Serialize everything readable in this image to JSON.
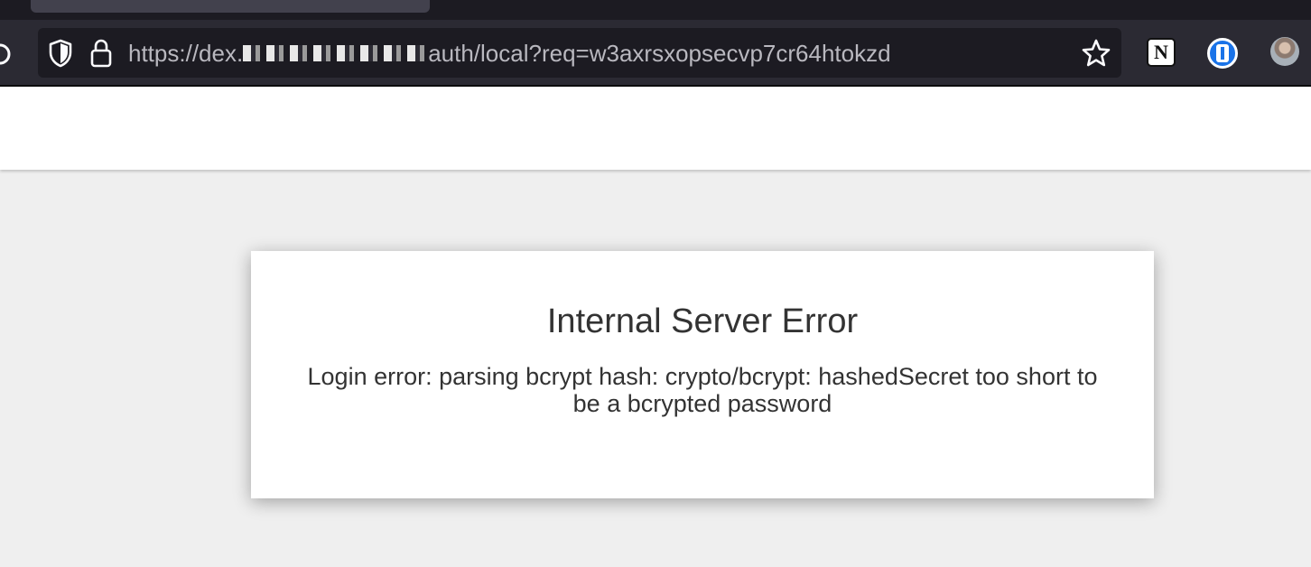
{
  "browser": {
    "url": {
      "prefix": "https://dex.",
      "suffix": "auth/local?req=w3axrsxopsecvp7cr64htokzd"
    },
    "extensions": {
      "notion_letter": "N"
    }
  },
  "error": {
    "title": "Internal Server Error",
    "message": "Login error: parsing bcrypt hash: crypto/bcrypt: hashedSecret too short to be a bcrypted password"
  }
}
